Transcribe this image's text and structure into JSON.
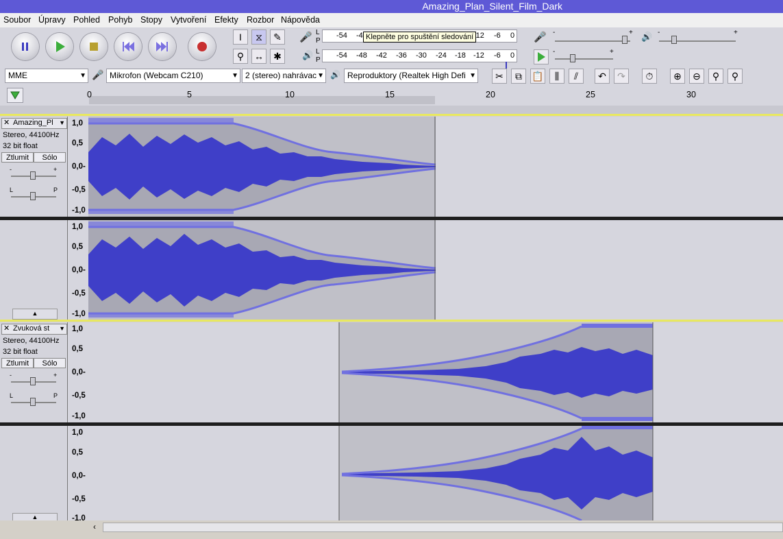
{
  "window": {
    "title": "Amazing_Plan_Silent_Film_Dark"
  },
  "menu": [
    "Soubor",
    "Úpravy",
    "Pohled",
    "Pohyb",
    "Stopy",
    "Vytvoření",
    "Efekty",
    "Rozbor",
    "Nápověda"
  ],
  "transport": {
    "pause": "pause-icon",
    "play": "play-icon",
    "stop": "stop-icon",
    "skip_start": "skip-start-icon",
    "skip_end": "skip-end-icon",
    "record": "record-icon"
  },
  "meters": {
    "record_label_L": "L",
    "record_label_R": "P",
    "ticks_record": [
      "-54",
      "-4",
      "-12",
      "-6",
      "0"
    ],
    "ticks_play": [
      "-54",
      "-48",
      "-42",
      "-36",
      "-30",
      "-24",
      "-18",
      "-12",
      "-6",
      "0"
    ],
    "tooltip": "Klepněte pro spuštění sledování",
    "play_label_L": "L",
    "play_label_R": "P",
    "slider_minus": "-",
    "slider_plus": "+"
  },
  "devices": {
    "host": "MME",
    "input": "Mikrofon (Webcam C210)",
    "channels": "2 (stereo) nahrávac",
    "output": "Reproduktory (Realtek High Defi"
  },
  "ruler": {
    "labels": [
      "0",
      "5",
      "10",
      "15",
      "20",
      "25",
      "30"
    ]
  },
  "tracks": [
    {
      "name": "Amazing_Pl",
      "info1": "Stereo, 44100Hz",
      "info2": "32 bit float",
      "mute": "Ztlumit",
      "solo": "Sólo",
      "gain_minus": "-",
      "gain_plus": "+",
      "pan_left": "L",
      "pan_right": "P",
      "scale": [
        "1,0",
        "0,5",
        "0,0-",
        "-0,5",
        "-1,0"
      ]
    },
    {
      "name": "Zvuková st",
      "info1": "Stereo, 44100Hz",
      "info2": "32 bit float",
      "mute": "Ztlumit",
      "solo": "Sólo",
      "gain_minus": "-",
      "gain_plus": "+",
      "pan_left": "L",
      "pan_right": "P",
      "scale": [
        "1,0",
        "0,5",
        "0,0-",
        "-0,5",
        "-1,0"
      ]
    }
  ],
  "colors": {
    "titlebar": "#5e59d6",
    "wave": "#3f3fc8",
    "envelope": "#7070e0",
    "track_bg": "#d6d6de",
    "clip_bg": "#c0c0c8"
  }
}
